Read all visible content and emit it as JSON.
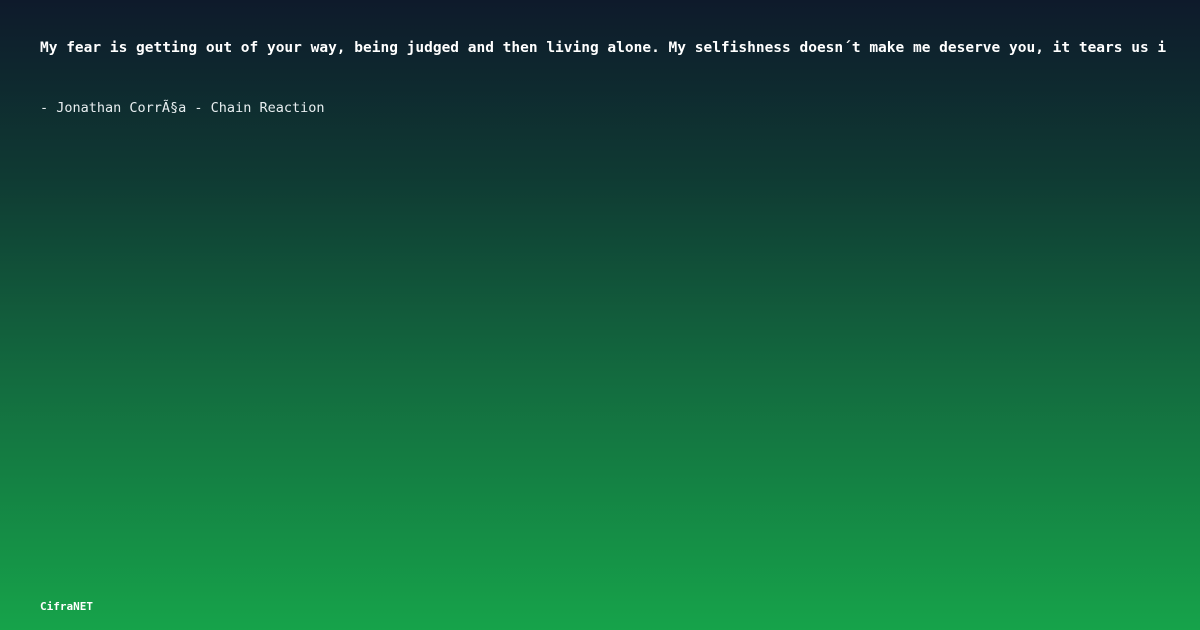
{
  "quote": {
    "text": "My fear is getting out of your way, being judged and then living alone. My selfishness doesn´t make me deserve you, it tears us i",
    "attribution": "- Jonathan CorrÃ§a - Chain Reaction"
  },
  "brand": {
    "name": "CifraNET"
  },
  "colors": {
    "gradient_top": "#0e1a2b",
    "gradient_bottom": "#16a34a",
    "text": "#ffffff"
  }
}
